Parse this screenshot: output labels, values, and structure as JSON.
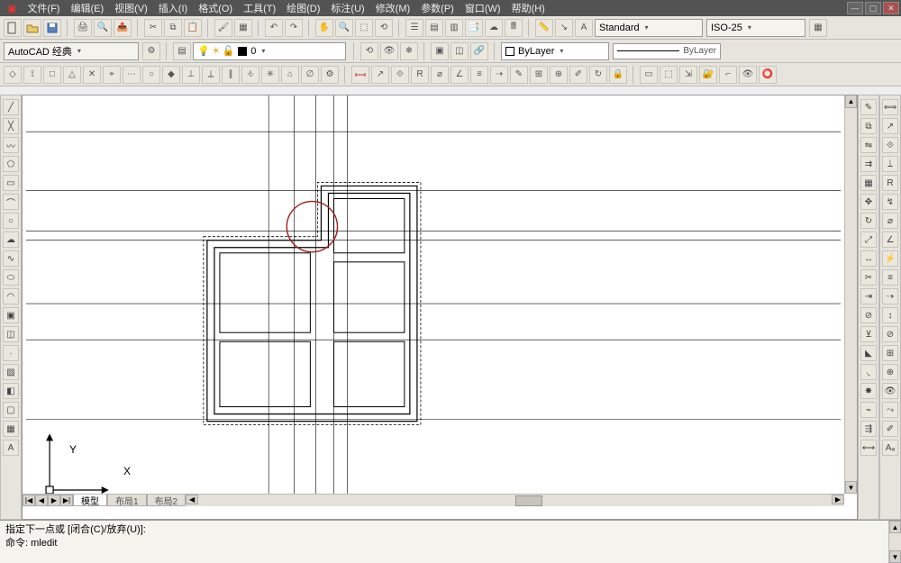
{
  "menu": {
    "items": [
      "文件(F)",
      "编辑(E)",
      "视图(V)",
      "插入(I)",
      "格式(O)",
      "工具(T)",
      "绘图(D)",
      "标注(U)",
      "修改(M)",
      "参数(P)",
      "窗口(W)",
      "帮助(H)"
    ]
  },
  "workspace": {
    "value": "AutoCAD 经典"
  },
  "layer": {
    "value": "0"
  },
  "textstyle": {
    "value": "Standard"
  },
  "dimstyle": {
    "value": "ISO-25"
  },
  "linetype": {
    "label": "ByLayer"
  },
  "linetype2": {
    "label": "ByLayer"
  },
  "tabs": {
    "model": "模型",
    "layout1": "布局1",
    "layout2": "布局2"
  },
  "nav": {
    "first": "|◀",
    "prev": "◀",
    "next": "▶",
    "last": "▶|"
  },
  "cmd": {
    "line1": "指定下一点或 [闭合(C)/放弃(U)]:",
    "line2": "命令: mledit",
    "line3": ""
  },
  "ucs": {
    "x": "X",
    "y": "Y"
  },
  "chart_data": {
    "type": "other",
    "description": "CAD floor-plan sketch with rectangular wall outlines and axis gridlines; a red highlight circle marks an editable multi-line joint near a re-entrant corner",
    "circle": {
      "cx_approx": 340,
      "cy_approx": 238,
      "r_approx": 30
    }
  },
  "icons": {
    "new": "new",
    "open": "open",
    "save": "save",
    "print": "print",
    "cut": "cut",
    "copy": "copy",
    "paste": "paste",
    "line": "line",
    "pline": "pline",
    "circle": "circle",
    "arc": "arc",
    "rect": "rect",
    "spline": "spline",
    "ellipse": "ellipse",
    "hatch": "hatch",
    "region": "region",
    "table": "table",
    "mtext": "mtext",
    "point": "point",
    "erase": "erase",
    "copyobj": "copyobj",
    "mirror": "mirror",
    "offset": "offset",
    "array": "array",
    "move": "move",
    "rotate": "rotate",
    "scale": "scale",
    "stretch": "stretch",
    "trim": "trim",
    "extend": "extend",
    "fillet": "fillet",
    "explode": "explode",
    "pan": "pan",
    "zoom": "zoom",
    "redo": "redo",
    "undo": "undo"
  }
}
